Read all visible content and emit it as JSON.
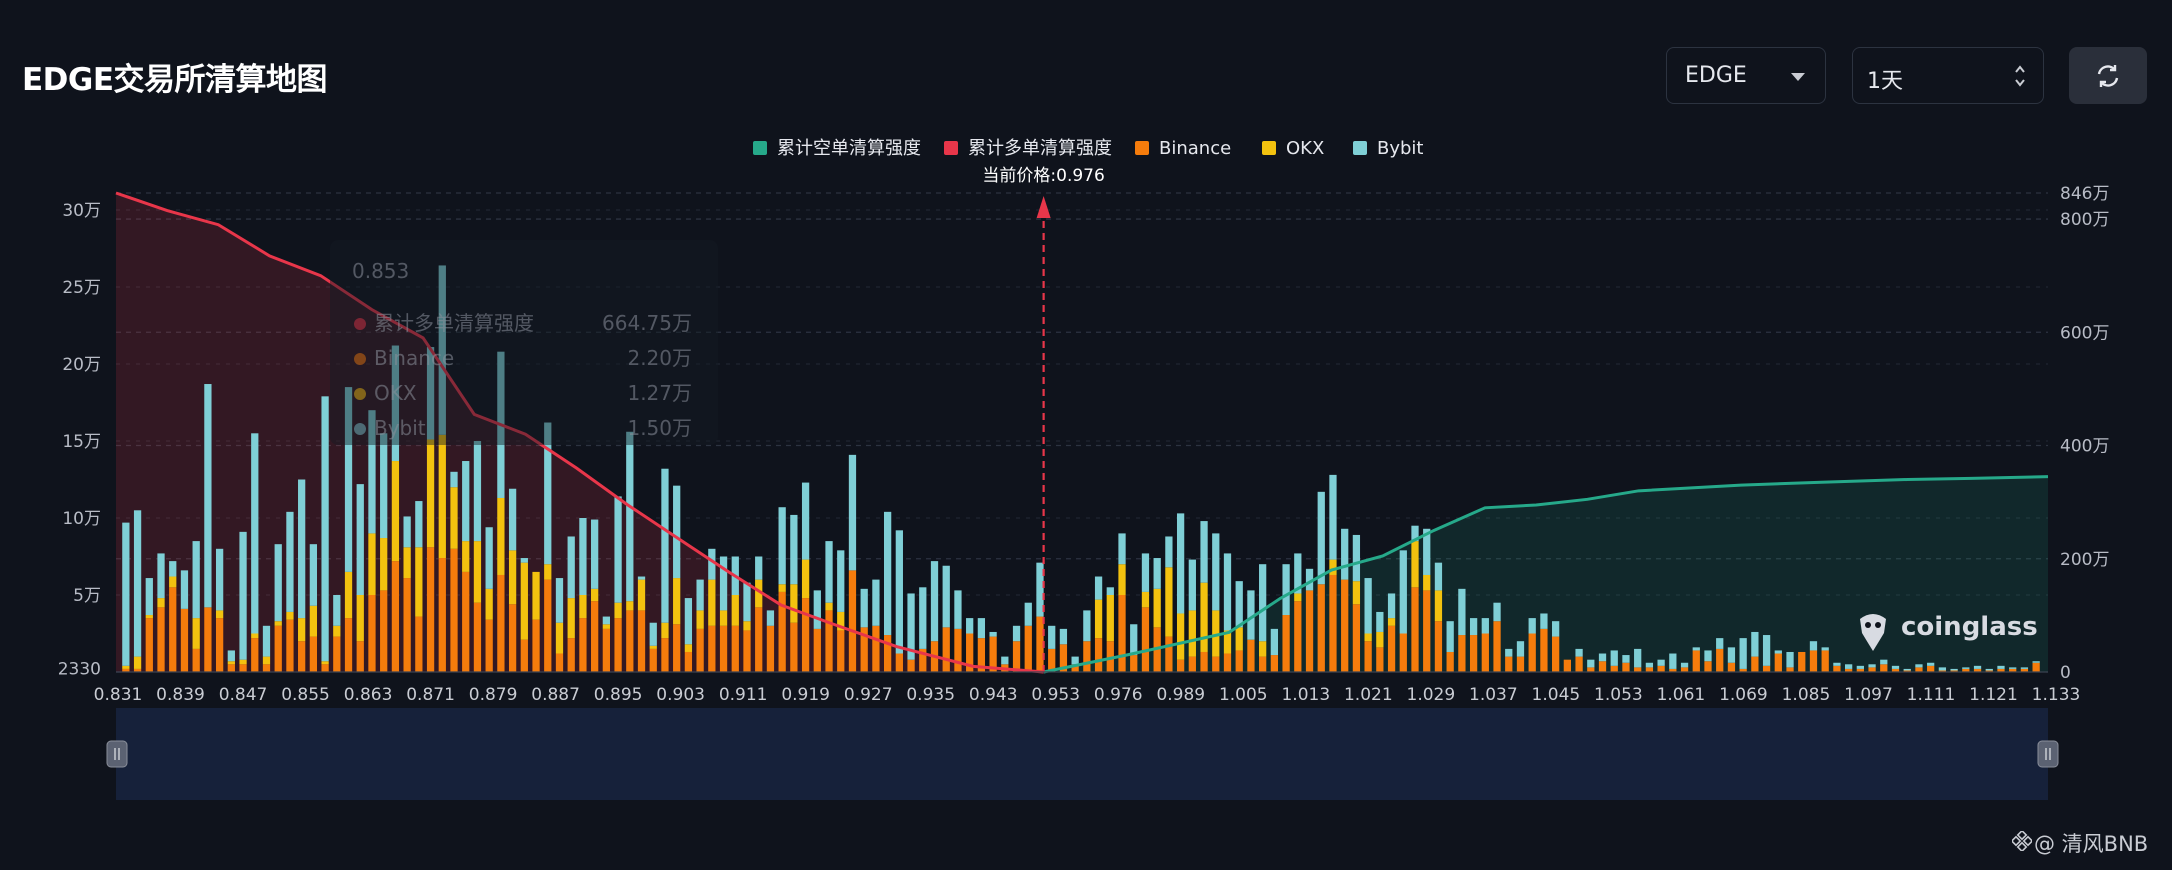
{
  "header": {
    "title": "EDGE交易所清算地图",
    "symbol_select": "EDGE",
    "range_select": "1天"
  },
  "legend": [
    {
      "label": "累计空单清算强度",
      "color": "#26a98a"
    },
    {
      "label": "累计多单清算强度",
      "color": "#e8364a"
    },
    {
      "label": "Binance",
      "color": "#f57c0c"
    },
    {
      "label": "OKX",
      "color": "#f3c20f"
    },
    {
      "label": "Bybit",
      "color": "#7fcfd6"
    }
  ],
  "current_price_label": "当前价格:0.976",
  "tooltip": {
    "price": "0.853",
    "rows": [
      {
        "label": "累计多单清算强度",
        "value": "664.75万"
      },
      {
        "label": "Binance",
        "value": "2.20万"
      },
      {
        "label": "OKX",
        "value": "1.27万"
      },
      {
        "label": "Bybit",
        "value": "1.50万"
      }
    ]
  },
  "brand": "coinglass",
  "credit": "@ 清风BNB",
  "chart_data": {
    "type": "bar",
    "x_tick_labels": [
      "0.831",
      "0.839",
      "0.847",
      "0.855",
      "0.863",
      "0.871",
      "0.879",
      "0.887",
      "0.895",
      "0.903",
      "0.911",
      "0.919",
      "0.927",
      "0.935",
      "0.943",
      "0.953",
      "0.976",
      "0.989",
      "1.005",
      "1.013",
      "1.021",
      "1.029",
      "1.037",
      "1.045",
      "1.053",
      "1.061",
      "1.069",
      "1.085",
      "1.097",
      "1.111",
      "1.121",
      "1.133"
    ],
    "left_axis": {
      "ticks": [
        "2330",
        "5万",
        "10万",
        "15万",
        "20万",
        "25万",
        "30万"
      ],
      "tick_values": [
        2330,
        50000,
        100000,
        150000,
        200000,
        250000,
        300000
      ],
      "range": [
        0,
        300000
      ]
    },
    "right_axis": {
      "ticks": [
        "0",
        "200万",
        "400万",
        "600万",
        "800万",
        "846万"
      ],
      "tick_values": [
        0,
        2000000,
        4000000,
        6000000,
        8000000,
        8460000
      ],
      "range": [
        0,
        8460000
      ]
    },
    "current_price": 0.976,
    "series": [
      {
        "name": "Binance",
        "values": [
          2000,
          2000,
          35000,
          42000,
          55000,
          41000,
          15000,
          42000,
          35000,
          5000,
          5000,
          22000,
          5000,
          30000,
          34000,
          20000,
          23000,
          5000,
          23000,
          35000,
          20000,
          50000,
          53000,
          72000,
          61000,
          36000,
          81000,
          74000,
          80000,
          65000,
          45000,
          34000,
          63000,
          44000,
          21000,
          34000,
          60000,
          12000,
          22000,
          35000,
          46000,
          28000,
          35000,
          40000,
          40000,
          15000,
          22000,
          31000,
          13000,
          28000,
          30000,
          30000,
          30000,
          27000,
          42000,
          30000,
          52000,
          32000,
          48000,
          28000,
          40000,
          27000,
          66000,
          29000,
          30000,
          24000,
          12000,
          8000,
          15000,
          20000,
          29000,
          28000,
          25000,
          22000,
          23000,
          5000,
          20000,
          30000,
          36000,
          15000,
          18000,
          5000,
          20000,
          22000,
          20000,
          50000,
          11000,
          42000,
          29000,
          23000,
          8000,
          10000,
          13000,
          10000,
          12000,
          14000,
          21000,
          10000,
          11000,
          37000,
          46000,
          53000,
          57000,
          63000,
          60000,
          44000,
          20000,
          16000,
          30000,
          25000,
          55000,
          53000,
          33000,
          13000,
          24000,
          24000,
          25000,
          33000,
          10000,
          10000,
          25000,
          28000,
          23000,
          8000,
          10000,
          3000,
          7000,
          4000,
          6000,
          3000,
          3000,
          4000,
          2000,
          3000,
          14000,
          7000,
          15000,
          6000,
          2000,
          10000,
          4000,
          12000,
          3000,
          13000,
          14000,
          14000,
          4000,
          2000,
          2000,
          3000,
          5000,
          2000,
          1000,
          3000,
          4000,
          1000,
          1000,
          2000,
          2000,
          1000,
          2000,
          2000,
          2000,
          6000
        ],
        "note": null
      },
      {
        "name": "OKX",
        "values": [
          2000,
          8000,
          2000,
          6000,
          7000,
          0,
          20000,
          0,
          5000,
          2000,
          3000,
          3000,
          5000,
          3000,
          5000,
          15000,
          20000,
          2000,
          7000,
          30000,
          30000,
          40000,
          34000,
          65000,
          20000,
          45000,
          70000,
          80000,
          40000,
          20000,
          40000,
          20000,
          50000,
          35000,
          50000,
          31000,
          10000,
          20000,
          26000,
          15000,
          8000,
          3000,
          10000,
          6000,
          20000,
          2000,
          10000,
          30000,
          5000,
          12000,
          30000,
          10000,
          20000,
          6000,
          18000,
          0,
          5000,
          25000,
          25000,
          0,
          5000,
          12000,
          0,
          0,
          0,
          0,
          0,
          0,
          0,
          0,
          0,
          0,
          0,
          0,
          0,
          0,
          0,
          0,
          0,
          0,
          0,
          0,
          0,
          25000,
          30000,
          20000,
          0,
          10000,
          25000,
          45000,
          30000,
          30000,
          45000,
          30000,
          15000,
          15000,
          0,
          10000,
          0,
          0,
          5000,
          0,
          0,
          10000,
          0,
          15000,
          5000,
          10000,
          5000,
          0,
          30000,
          10000,
          20000,
          0,
          0,
          0,
          0,
          0,
          0,
          0,
          0,
          0,
          0,
          0,
          0,
          0,
          0,
          0,
          0,
          0,
          0,
          0,
          0,
          0,
          0,
          0,
          0,
          0,
          0,
          0,
          0,
          0,
          0,
          0,
          0,
          0,
          0,
          0,
          0,
          0,
          0,
          0,
          0,
          0,
          0,
          0,
          0,
          0,
          0,
          0,
          0,
          0,
          0,
          0
        ],
        "note": null
      },
      {
        "name": "Bybit",
        "values": [
          93000,
          95000,
          24000,
          29000,
          10000,
          25000,
          50000,
          145000,
          40000,
          7000,
          83000,
          130000,
          20000,
          50000,
          65000,
          90000,
          40000,
          172000,
          20000,
          120000,
          72000,
          80000,
          68000,
          75000,
          20000,
          30000,
          60000,
          110000,
          10000,
          52000,
          65000,
          40000,
          95000,
          40000,
          3000,
          0,
          92000,
          29000,
          40000,
          50000,
          45000,
          5000,
          69000,
          110000,
          2000,
          15000,
          100000,
          60000,
          30000,
          20000,
          20000,
          35000,
          25000,
          25000,
          15000,
          10000,
          50000,
          45000,
          50000,
          25000,
          40000,
          40000,
          75000,
          25000,
          30000,
          80000,
          80000,
          43000,
          40000,
          52000,
          40000,
          25000,
          10000,
          13000,
          3000,
          5000,
          10000,
          15000,
          35000,
          15000,
          10000,
          5000,
          20000,
          15000,
          5000,
          20000,
          20000,
          25000,
          20000,
          20000,
          65000,
          33000,
          40000,
          50000,
          50000,
          30000,
          32000,
          50000,
          17000,
          33000,
          26000,
          14000,
          60000,
          55000,
          33000,
          30000,
          36000,
          13000,
          16000,
          54000,
          10000,
          30000,
          18000,
          20000,
          30000,
          11000,
          10000,
          12000,
          5000,
          10000,
          10000,
          10000,
          10000,
          0,
          5000,
          5000,
          5000,
          10000,
          5000,
          12000,
          3000,
          4000,
          10000,
          3000,
          2000,
          7000,
          7000,
          10000,
          20000,
          16000,
          20000,
          2000,
          10000,
          0,
          6000,
          2000,
          2000,
          3000,
          2000,
          2000,
          3000,
          2000,
          1000,
          2000,
          2000,
          2000,
          1000,
          1000,
          2000,
          1000,
          2000,
          1000,
          1000,
          1000
        ],
        "note": null
      },
      {
        "name": "累计多单清算强度",
        "values_万": [
          [
            0.831,
            846
          ],
          [
            0.839,
            815
          ],
          [
            0.847,
            790
          ],
          [
            0.855,
            735
          ],
          [
            0.863,
            700
          ],
          [
            0.871,
            640
          ],
          [
            0.879,
            590
          ],
          [
            0.887,
            455
          ],
          [
            0.895,
            420
          ],
          [
            0.903,
            360
          ],
          [
            0.911,
            295
          ],
          [
            0.919,
            235
          ],
          [
            0.927,
            175
          ],
          [
            0.935,
            118
          ],
          [
            0.943,
            85
          ],
          [
            0.953,
            45
          ],
          [
            0.965,
            10
          ],
          [
            0.976,
            0
          ]
        ]
      },
      {
        "name": "累计空单清算强度",
        "values_万": [
          [
            0.976,
            0
          ],
          [
            0.989,
            30
          ],
          [
            1.005,
            70
          ],
          [
            1.013,
            130
          ],
          [
            1.021,
            180
          ],
          [
            1.029,
            205
          ],
          [
            1.037,
            250
          ],
          [
            1.045,
            290
          ],
          [
            1.053,
            295
          ],
          [
            1.061,
            305
          ],
          [
            1.069,
            320
          ],
          [
            1.085,
            330
          ],
          [
            1.097,
            335
          ],
          [
            1.111,
            340
          ],
          [
            1.121,
            342
          ],
          [
            1.133,
            345
          ]
        ]
      }
    ]
  }
}
